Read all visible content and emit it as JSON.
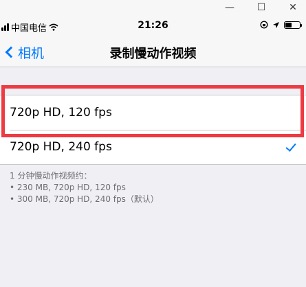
{
  "window": {
    "minimize_icon": "—",
    "maximize_icon": "☐",
    "close_icon": "✕"
  },
  "status": {
    "carrier": "中国电信",
    "time": "21:26"
  },
  "nav": {
    "back_label": "相机",
    "title": "录制慢动作视频"
  },
  "options": [
    {
      "label": "720p HD, 120 fps",
      "selected": false
    },
    {
      "label": "720p HD, 240 fps",
      "selected": true
    }
  ],
  "footer": {
    "line1": "1 分钟慢动作视频约：",
    "line2": "• 230 MB, 720p HD, 120 fps",
    "line3": "• 300 MB, 720p HD, 240 fps（默认）"
  },
  "colors": {
    "accent": "#007aff",
    "highlight": "#ee3a42",
    "background": "#f0eff4"
  }
}
